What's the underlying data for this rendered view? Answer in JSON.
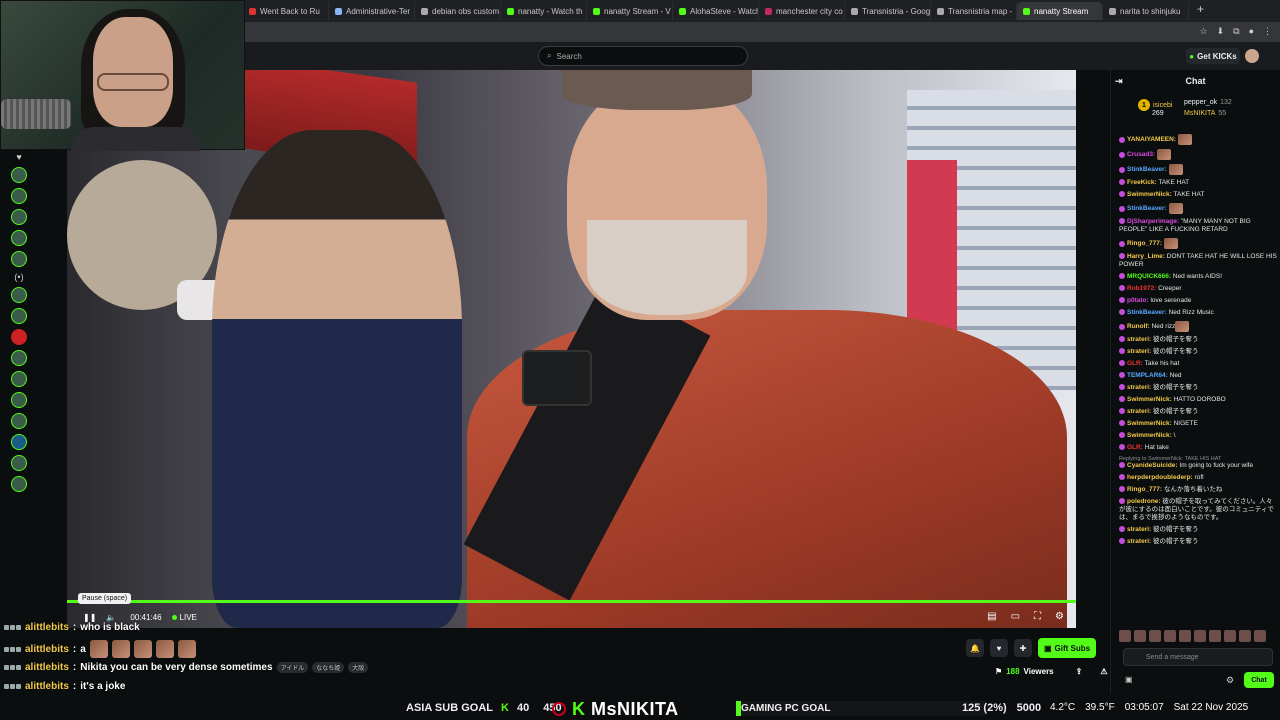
{
  "browser": {
    "tabs": [
      {
        "title": "Went Back to Ru",
        "color": "#d33"
      },
      {
        "title": "Administrative-Ter",
        "color": "#8ab4f8"
      },
      {
        "title": "debian obs custom",
        "color": "#aaa"
      },
      {
        "title": "nanatty - Watch th",
        "color": "#53fc18"
      },
      {
        "title": "nanatty Stream - V",
        "color": "#53fc18"
      },
      {
        "title": "AlohaSteve - Watch",
        "color": "#53fc18"
      },
      {
        "title": "manchester city co",
        "color": "#c02a5a"
      },
      {
        "title": "Transnistria - Goog",
        "color": "#aaa"
      },
      {
        "title": "Transnistria map -",
        "color": "#aaa"
      },
      {
        "title": "nanatty Stream",
        "color": "#53fc18"
      },
      {
        "title": "narita to shinjuku",
        "color": "#aaa"
      }
    ],
    "active_tab_index": 9
  },
  "kick_header": {
    "search_placeholder": "Search",
    "get_kicks": "Get KICKs"
  },
  "player": {
    "tooltip": "Pause (space)",
    "time": "00:41:46",
    "live": "LIVE",
    "accent": "#53fc18"
  },
  "overlay_chat": [
    {
      "name": "alittlebits",
      "message": "who is black"
    },
    {
      "name": "alittlebits",
      "message": "a"
    },
    {
      "name": "alittlebits",
      "message": "Nikita you can be very dense sometimes",
      "tags": [
        "アイドル",
        "ななち姫",
        "大阪"
      ]
    },
    {
      "name": "alittlebits",
      "message": "it's a joke"
    },
    {
      "name": "alittlebits",
      "message": ""
    }
  ],
  "stream_actions": {
    "gift_subs": "Gift Subs",
    "viewers": "188",
    "viewers_label": "Viewers"
  },
  "chat": {
    "title": "Chat",
    "leaderboard": [
      {
        "rank": "1",
        "name": "isicebi",
        "count": "269"
      },
      {
        "name": "pepper_ok",
        "count": "132"
      },
      {
        "name": "MsNIKITA",
        "count": "55"
      }
    ],
    "messages": [
      {
        "user": "YANAIYAMEEN:",
        "text": "",
        "color": "#f2c94c",
        "emote": true
      },
      {
        "user": "Crusad3:",
        "text": "",
        "color": "#d94ade",
        "emote": true
      },
      {
        "user": "StinkBeaver:",
        "text": "",
        "color": "#5aa8ff",
        "emote": true
      },
      {
        "user": "FreeKick:",
        "text": "TAKE HAT",
        "color": "#f2c94c"
      },
      {
        "user": "SwimmerNick:",
        "text": "TAKE HAT",
        "color": "#f2c94c"
      },
      {
        "user": "StinkBeaver:",
        "text": "",
        "color": "#5aa8ff",
        "emote": true
      },
      {
        "user": "DjSharperimage:",
        "text": "\"MANY MANY NOT BIG PEOPLE\" LIKE A FUCKING RETARD",
        "color": "#d94ade"
      },
      {
        "user": "Ringo_777:",
        "text": "",
        "color": "#f2c94c",
        "emote": true
      },
      {
        "user": "Harry_Lime:",
        "text": "DONT TAKE HAT HE WILL LOSE HIS POWER",
        "color": "#f2c94c"
      },
      {
        "user": "MRQUICK666:",
        "text": "Ned wants AIDS!",
        "color": "#53fc18"
      },
      {
        "user": "Rob1972:",
        "text": "Creeper",
        "color": "#e33"
      },
      {
        "user": "p0tato:",
        "text": "love serenade",
        "color": "#d94ade"
      },
      {
        "user": "StinkBeaver:",
        "text": "Ned Rizz Music",
        "color": "#5aa8ff"
      },
      {
        "user": "Runolf:",
        "text": "Ned rizz",
        "color": "#f2c94c",
        "emote": true
      },
      {
        "user": "strateri:",
        "text": "彼の帽子を奪う",
        "color": "#f2c94c"
      },
      {
        "user": "strateri:",
        "text": "彼の帽子を奪う",
        "color": "#f2c94c"
      },
      {
        "user": "GLR:",
        "text": "Take his hat",
        "color": "#e33"
      },
      {
        "user": "TEMPLAR64:",
        "text": "Ned",
        "color": "#5aa8ff"
      },
      {
        "user": "strateri:",
        "text": "彼の帽子を奪う",
        "color": "#f2c94c"
      },
      {
        "user": "SwimmerNick:",
        "text": "HATTO DOROBO",
        "color": "#f2c94c"
      },
      {
        "user": "strateri:",
        "text": "彼の帽子を奪う",
        "color": "#f2c94c"
      },
      {
        "user": "SwimmerNick:",
        "text": "NIGETE",
        "color": "#f2c94c"
      },
      {
        "user": "SwimmerNick:",
        "text": "\\",
        "color": "#f2c94c"
      },
      {
        "user": "GLR:",
        "text": "Hat take",
        "color": "#e33"
      },
      {
        "user": "CyanideSuicide:",
        "text": "Im going to fuck your wife",
        "color": "#f2c94c",
        "reply": "Replying to SwimmerNick: TAKE HIS HAT"
      },
      {
        "user": "herpderpdoublederp:",
        "text": "rofl",
        "color": "#f2c94c"
      },
      {
        "user": "Ringo_777:",
        "text": "なんか落ち着いたね",
        "color": "#f2c94c"
      },
      {
        "user": "poledrone:",
        "text": "彼の帽子を取ってみてください。人々が彼にするのは面白いことです。彼のコミュニティでは、まるで挨拶のようなものです。",
        "color": "#f2c94c"
      },
      {
        "user": "strateri:",
        "text": "彼の帽子を奪う",
        "color": "#f2c94c"
      },
      {
        "user": "strateri:",
        "text": "彼の帽子を奪う",
        "color": "#f2c94c"
      }
    ],
    "send_placeholder": "Send a message",
    "chat_button": "Chat"
  },
  "obs_bar": {
    "asia_sub_goal_label": "ASIA SUB GOAL",
    "asia_sub_goal_current": "40",
    "asia_sub_goal_target": "450",
    "logo_k": "K",
    "logo_text": "MsNIKITA",
    "gaming_goal_label": "GAMING PC GOAL",
    "gaming_goal_current": "125 (2%)",
    "gaming_goal_target": "5000",
    "temp_c": "4.2°C",
    "temp_f": "39.5°F",
    "clock": "03:05:07",
    "date": "Sat 22 Nov 2025"
  }
}
